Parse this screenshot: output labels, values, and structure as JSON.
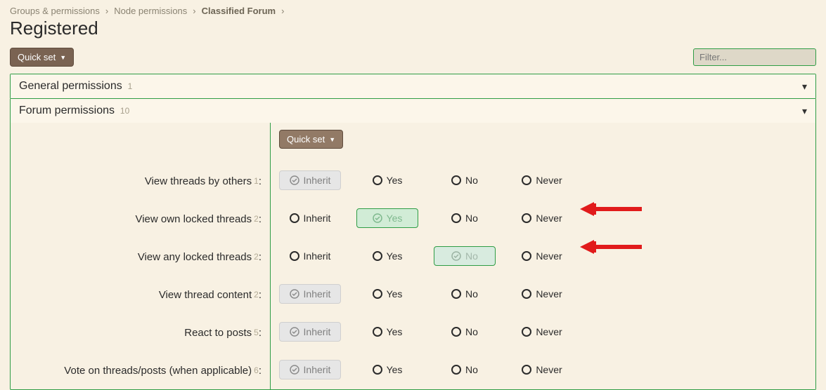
{
  "breadcrumbs": {
    "a": "Groups & permissions",
    "b": "Node permissions",
    "c": "Classified Forum"
  },
  "page_title": "Registered",
  "quick_set_label": "Quick set",
  "filter_placeholder": "Filter...",
  "sections": {
    "general": {
      "title": "General permissions",
      "count": "1"
    },
    "forum": {
      "title": "Forum permissions",
      "count": "10"
    }
  },
  "opt_labels": {
    "inherit": "Inherit",
    "yes": "Yes",
    "no": "No",
    "never": "Never"
  },
  "rows": [
    {
      "label": "View threads by others",
      "count": "1",
      "selected": "inherit"
    },
    {
      "label": "View own locked threads",
      "count": "2",
      "selected": "yes"
    },
    {
      "label": "View any locked threads",
      "count": "2",
      "selected": "no"
    },
    {
      "label": "View thread content",
      "count": "2",
      "selected": "inherit"
    },
    {
      "label": "React to posts",
      "count": "5",
      "selected": "inherit"
    },
    {
      "label": "Vote on threads/posts (when applicable)",
      "count": "6",
      "selected": "inherit"
    }
  ]
}
